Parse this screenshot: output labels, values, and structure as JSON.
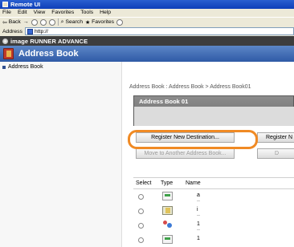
{
  "window": {
    "title": "Remote UI"
  },
  "menu": [
    "File",
    "Edit",
    "View",
    "Favorites",
    "Tools",
    "Help"
  ],
  "toolbar": {
    "back_label": "Back",
    "forward_label": "→",
    "search_label": "Search",
    "favorites_label": "Favorites"
  },
  "address": {
    "label": "Address",
    "value": "http://"
  },
  "brand": {
    "title": "image RUNNER ADVANCE"
  },
  "header": {
    "title": "Address Book"
  },
  "sidebar": {
    "items": [
      {
        "label": "Address Book"
      }
    ]
  },
  "main": {
    "breadcrumb": "Address Book : Address Book > Address Book01",
    "book_name": "Address Book 01",
    "buttons": {
      "register_new_destination": "Register New Destination...",
      "register_cut": "Register N",
      "move": "Move to Another Address Book...",
      "d_cut": "D"
    },
    "table": {
      "headers": [
        "Select",
        "Type",
        "Name"
      ],
      "rows": [
        {
          "type_icon": "fax-icon",
          "name": "a",
          "sub": "--"
        },
        {
          "type_icon": "mail-icon",
          "name": "i",
          "sub": "--"
        },
        {
          "type_icon": "group-icon",
          "name": "1",
          "sub": "--"
        },
        {
          "type_icon": "fax-icon",
          "name": "1",
          "sub": ""
        }
      ]
    }
  },
  "colors": {
    "highlight": "#f08a24",
    "header_blue": "#2f5aa6"
  }
}
